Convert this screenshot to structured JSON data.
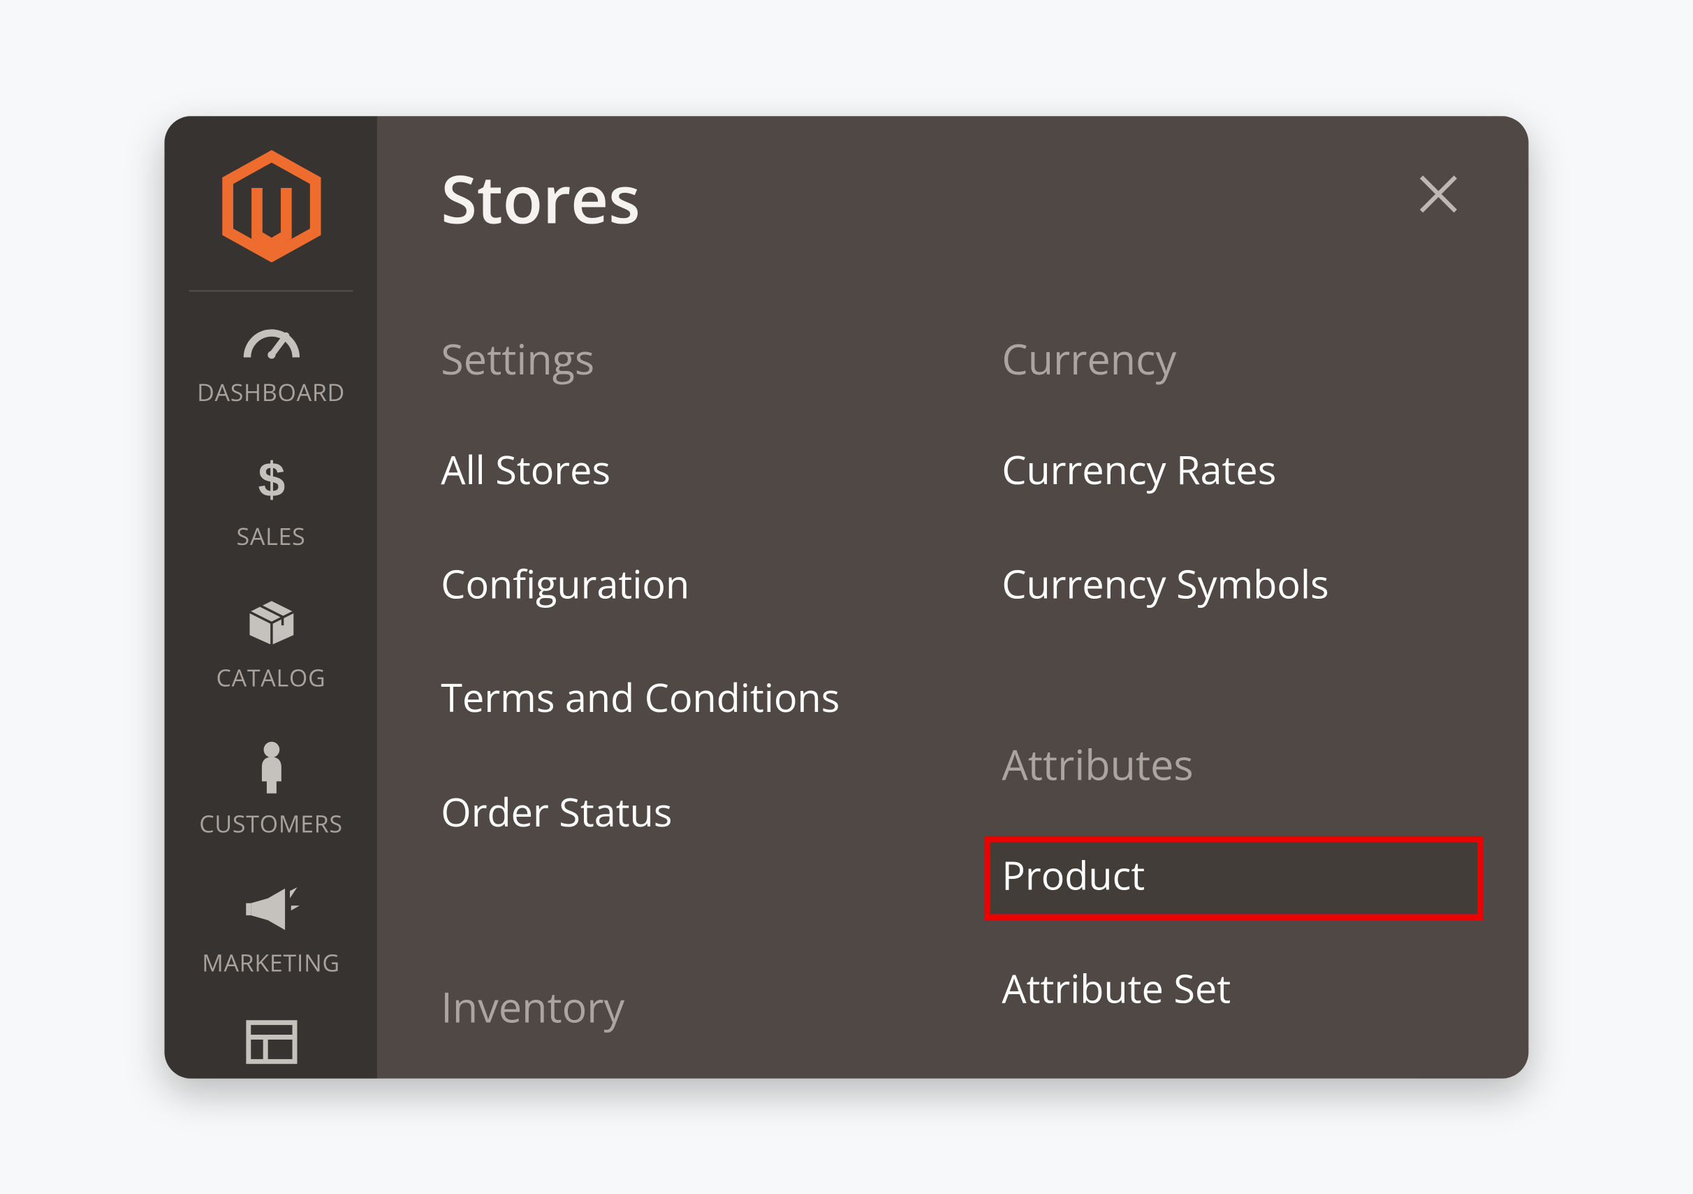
{
  "colors": {
    "brand_orange": "#ef6c2f",
    "highlight_red": "#ec0000",
    "sidebar_bg": "#373330",
    "panel_bg": "#4f4845"
  },
  "sidebar": {
    "items": [
      {
        "label": "DASHBOARD",
        "icon": "gauge-icon"
      },
      {
        "label": "SALES",
        "icon": "dollar-icon"
      },
      {
        "label": "CATALOG",
        "icon": "box-icon"
      },
      {
        "label": "CUSTOMERS",
        "icon": "person-icon"
      },
      {
        "label": "MARKETING",
        "icon": "megaphone-icon"
      }
    ]
  },
  "panel": {
    "title": "Stores",
    "groups": {
      "left": [
        {
          "heading": "Settings",
          "items": [
            {
              "label": "All Stores"
            },
            {
              "label": "Configuration"
            },
            {
              "label": "Terms and Conditions"
            },
            {
              "label": "Order Status"
            }
          ]
        },
        {
          "heading": "Inventory",
          "items": []
        }
      ],
      "right": [
        {
          "heading": "Currency",
          "items": [
            {
              "label": "Currency Rates"
            },
            {
              "label": "Currency Symbols"
            }
          ]
        },
        {
          "heading": "Attributes",
          "items": [
            {
              "label": "Product",
              "highlighted": true
            },
            {
              "label": "Attribute Set"
            }
          ]
        }
      ]
    }
  }
}
